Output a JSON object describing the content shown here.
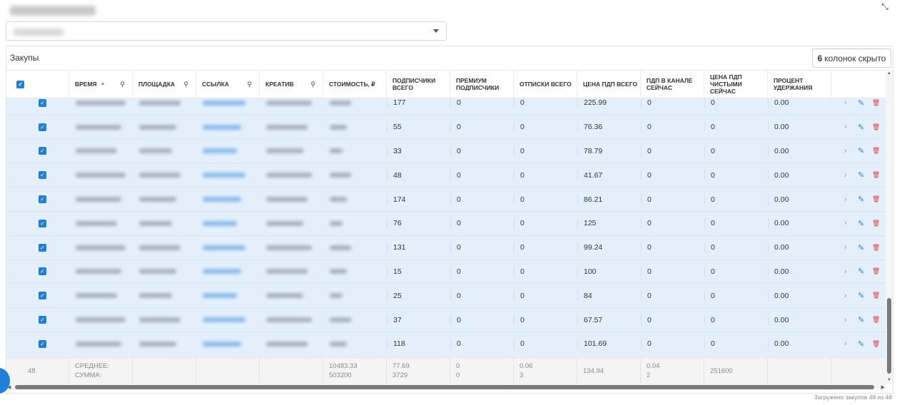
{
  "header": {
    "select_value": ""
  },
  "panel": {
    "title": "Закупы",
    "hidden_count": "6",
    "hidden_label": "колонок скрыто"
  },
  "columns": [
    {
      "key": "check",
      "label": ""
    },
    {
      "key": "time",
      "label": "Время",
      "sort": "▲",
      "search": true
    },
    {
      "key": "platform",
      "label": "Площадка",
      "search": true
    },
    {
      "key": "link",
      "label": "Ссылка",
      "search": true
    },
    {
      "key": "creative",
      "label": "Креатив",
      "search": true
    },
    {
      "key": "cost",
      "label": "Стоимость, ₽"
    },
    {
      "key": "subs",
      "label": "Подписчики всего"
    },
    {
      "key": "premium",
      "label": "Премиум подписчики"
    },
    {
      "key": "unsubs",
      "label": "Отписки всего"
    },
    {
      "key": "cpf",
      "label": "Цена ПДП всего"
    },
    {
      "key": "in_channel",
      "label": "ПДП в канале сейчас"
    },
    {
      "key": "cpf_net",
      "label": "Цена ПДП чистыми сейчас"
    },
    {
      "key": "retention",
      "label": "Процент удержания"
    }
  ],
  "rows": [
    {
      "subs": "177",
      "premium": "0",
      "unsubs": "0",
      "cpf": "225.99",
      "in_channel": "0",
      "cpf_net": "0",
      "retention": "0.00"
    },
    {
      "subs": "55",
      "premium": "0",
      "unsubs": "0",
      "cpf": "76.36",
      "in_channel": "0",
      "cpf_net": "0",
      "retention": "0.00"
    },
    {
      "subs": "33",
      "premium": "0",
      "unsubs": "0",
      "cpf": "78.79",
      "in_channel": "0",
      "cpf_net": "0",
      "retention": "0.00"
    },
    {
      "subs": "48",
      "premium": "0",
      "unsubs": "0",
      "cpf": "41.67",
      "in_channel": "0",
      "cpf_net": "0",
      "retention": "0.00"
    },
    {
      "subs": "174",
      "premium": "0",
      "unsubs": "0",
      "cpf": "86.21",
      "in_channel": "0",
      "cpf_net": "0",
      "retention": "0.00"
    },
    {
      "subs": "76",
      "premium": "0",
      "unsubs": "0",
      "cpf": "125",
      "in_channel": "0",
      "cpf_net": "0",
      "retention": "0.00"
    },
    {
      "subs": "131",
      "premium": "0",
      "unsubs": "0",
      "cpf": "99.24",
      "in_channel": "0",
      "cpf_net": "0",
      "retention": "0.00"
    },
    {
      "subs": "15",
      "premium": "0",
      "unsubs": "0",
      "cpf": "100",
      "in_channel": "0",
      "cpf_net": "0",
      "retention": "0.00"
    },
    {
      "subs": "25",
      "premium": "0",
      "unsubs": "0",
      "cpf": "84",
      "in_channel": "0",
      "cpf_net": "0",
      "retention": "0.00"
    },
    {
      "subs": "37",
      "premium": "0",
      "unsubs": "0",
      "cpf": "67.57",
      "in_channel": "0",
      "cpf_net": "0",
      "retention": "0.00"
    },
    {
      "subs": "118",
      "premium": "0",
      "unsubs": "0",
      "cpf": "101.69",
      "in_channel": "0",
      "cpf_net": "0",
      "retention": "0.00"
    }
  ],
  "footer": {
    "count": "48",
    "avg_label": "СРЕДНЕЕ:",
    "sum_label": "СУММА:",
    "cost": [
      "10483.33",
      "503200"
    ],
    "subs": [
      "77.69",
      "3729"
    ],
    "premium": [
      "0",
      "0"
    ],
    "unsubs": [
      "0.06",
      "3"
    ],
    "cpf": [
      "134.94",
      ""
    ],
    "in_channel": [
      "0.04",
      "2"
    ],
    "cpf_net": [
      "251600",
      ""
    ]
  },
  "status": {
    "loaded": "Загружено закупов 48 из 48"
  },
  "icons": {
    "checkbox": "checkbox-checked-icon",
    "search": "search-icon",
    "row_open": "chevron-right-icon",
    "row_edit": "pencil-icon",
    "row_delete": "trash-icon",
    "fullscreen": "collapse-icon",
    "select": "chevron-down-icon"
  },
  "colors": {
    "accent": "#1f7fd9",
    "row_selected": "#e3f0fc",
    "delete": "#e04040"
  }
}
